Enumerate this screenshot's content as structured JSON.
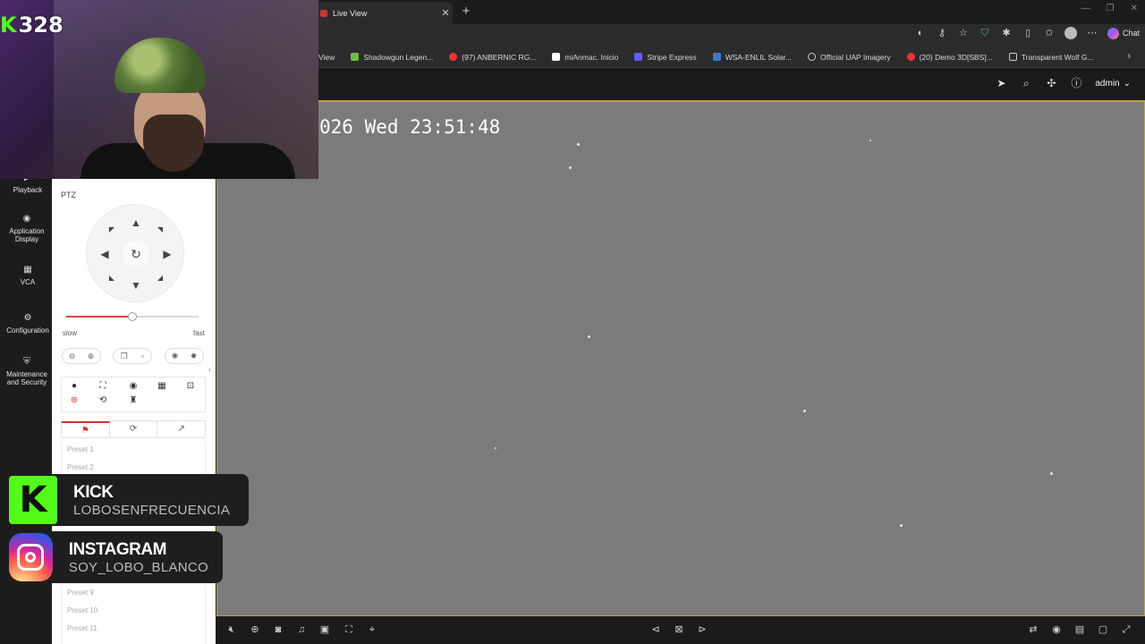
{
  "browser": {
    "tab_title": "Live View",
    "tab_close": "✕",
    "new_tab": "+",
    "window_controls": [
      "—",
      "❐",
      "✕"
    ],
    "chat_label": "Chat",
    "bookmarks": [
      {
        "label": "View",
        "color": "transparent"
      },
      {
        "label": "Shadowgun Legen...",
        "color": "#6bbf3f"
      },
      {
        "label": "(97) ANBERNIC RG...",
        "color": "#e33"
      },
      {
        "label": "miAnmac. Inicio",
        "color": "#222"
      },
      {
        "label": "Stripe Express",
        "color": "#635bff"
      },
      {
        "label": "WSA-ENLIL Solar...",
        "color": "#3a78c8"
      },
      {
        "label": "Official UAP Imagery",
        "color": "#888"
      },
      {
        "label": "(20) Demo 3D[SBS]...",
        "color": "#e33"
      },
      {
        "label": "Transparent Wolf G...",
        "color": "#aaa"
      }
    ],
    "bookmarks_more": "›"
  },
  "header": {
    "user": "admin",
    "user_caret": "⌄"
  },
  "nav": {
    "items": [
      {
        "label": "Playback",
        "icon": "▶"
      },
      {
        "label": "Application Display",
        "icon": "◉"
      },
      {
        "label": "VCA",
        "icon": "▦"
      },
      {
        "label": "Configuration",
        "icon": "⚙"
      },
      {
        "label": "Maintenance and Security",
        "icon": "⛨"
      }
    ]
  },
  "ptz": {
    "title": "PTZ",
    "speed_slow": "slow",
    "speed_fast": "fast",
    "speed_level": 0.5,
    "presets": [
      "Preset 1",
      "Preset 2",
      "Preset 9",
      "Preset 10",
      "Preset 11"
    ]
  },
  "video": {
    "osd_text": "026 Wed 23:51:48"
  },
  "overlay": {
    "badge_k": "K",
    "badge_num": "328",
    "kick": {
      "name": "KICK",
      "handle": "LOBOSENFRECUENCIA",
      "logo": "K"
    },
    "instagram": {
      "name": "INSTAGRAM",
      "handle": "SOY_LOBO_BLANCO"
    }
  },
  "colors": {
    "accent_border": "#b6a04a",
    "ptz_active": "#dd3333",
    "kick_green": "#53fc18"
  }
}
